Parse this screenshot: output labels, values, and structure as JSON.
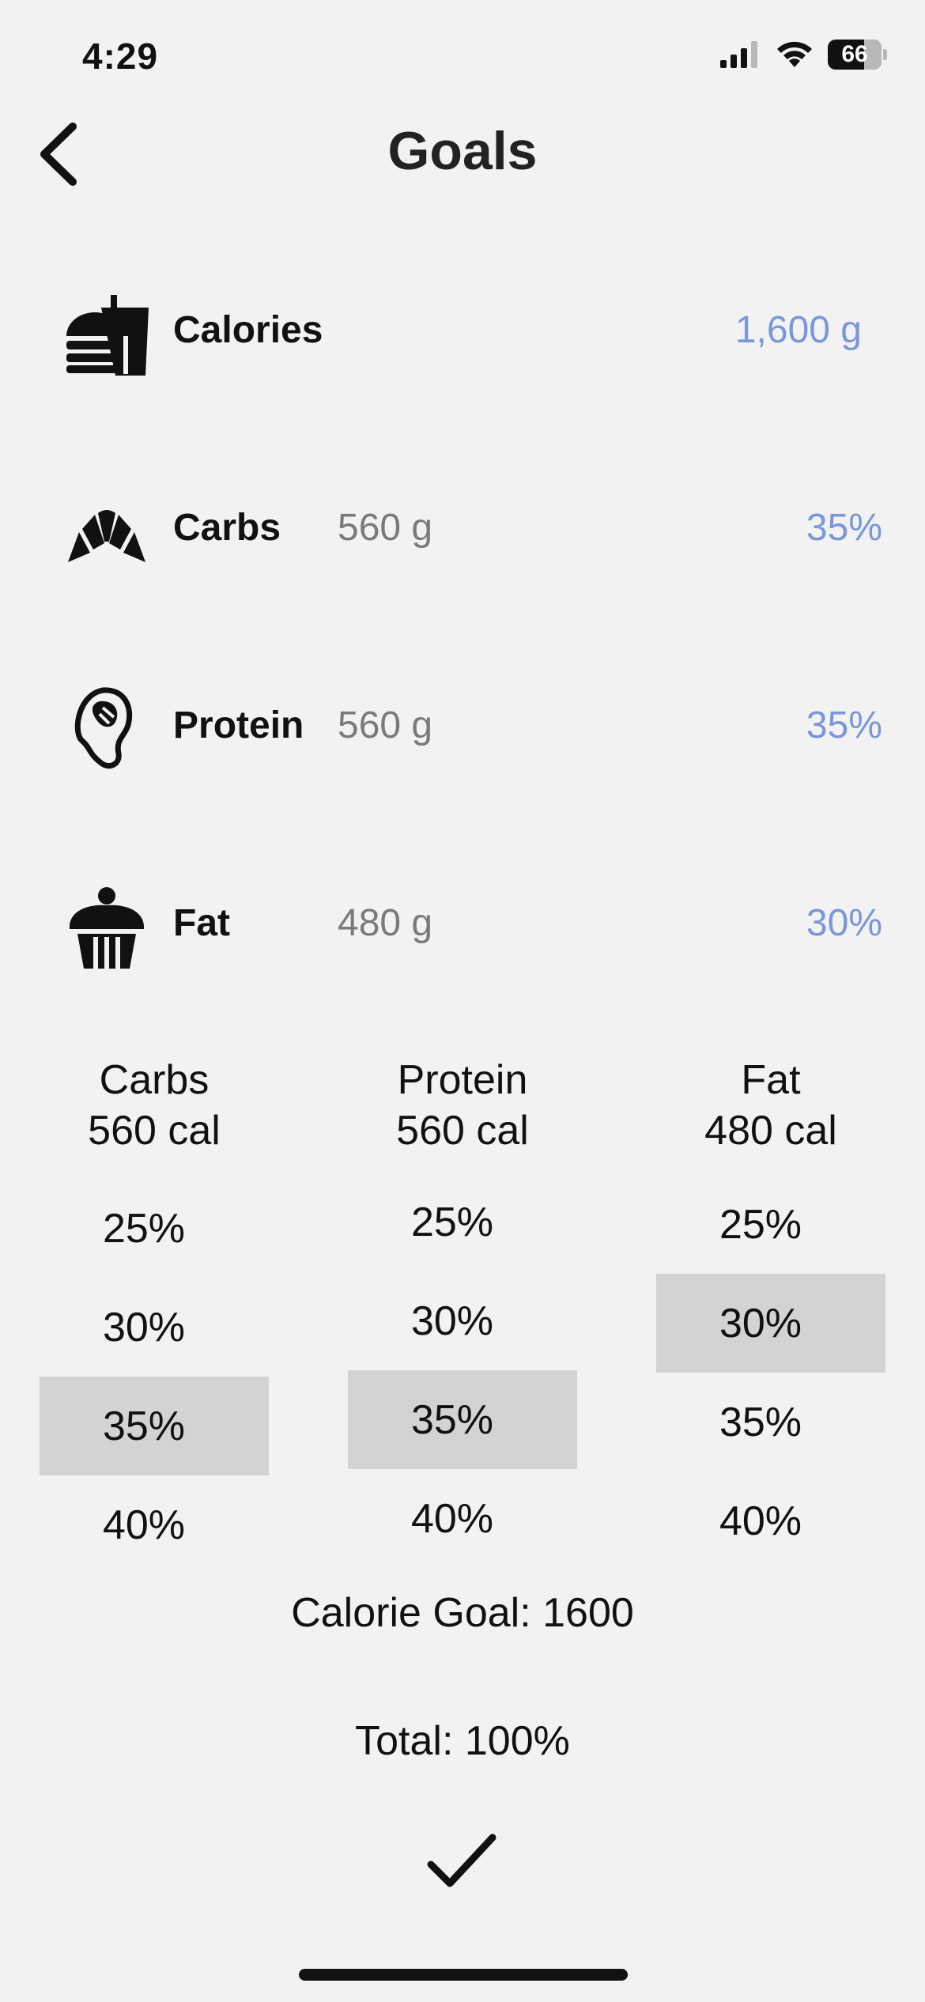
{
  "status_bar": {
    "time": "4:29",
    "battery": "66",
    "icons": [
      "signal-icon",
      "wifi-icon",
      "battery-icon"
    ]
  },
  "header": {
    "title": "Goals",
    "back_icon": "chevron-left-icon"
  },
  "macros": [
    {
      "label": "Calories",
      "grams": "",
      "value": "1,600 g",
      "icon": "fast-food-icon"
    },
    {
      "label": "Carbs",
      "grams": "560 g",
      "value": "35%",
      "icon": "croissant-icon"
    },
    {
      "label": "Protein",
      "grams": "560 g",
      "value": "35%",
      "icon": "steak-icon"
    },
    {
      "label": "Fat",
      "grams": "480 g",
      "value": "30%",
      "icon": "cupcake-icon"
    }
  ],
  "pickers": [
    {
      "name": "Carbs",
      "cal": "560 cal",
      "options": [
        "25%",
        "30%",
        "35%",
        "40%"
      ],
      "selected": "35%"
    },
    {
      "name": "Protein",
      "cal": "560 cal",
      "options": [
        "25%",
        "30%",
        "35%",
        "40%"
      ],
      "selected": "35%"
    },
    {
      "name": "Fat",
      "cal": "480 cal",
      "options": [
        "25%",
        "30%",
        "35%",
        "40%"
      ],
      "selected": "30%"
    }
  ],
  "calorie_goal": "Calorie Goal: 1600",
  "total": "Total: 100%",
  "confirm_icon": "checkmark-icon",
  "colors": {
    "background": "#f2f2f2",
    "accent": "#7a97d9",
    "muted": "#7a7a7a",
    "selected": "#d3d3d3"
  }
}
